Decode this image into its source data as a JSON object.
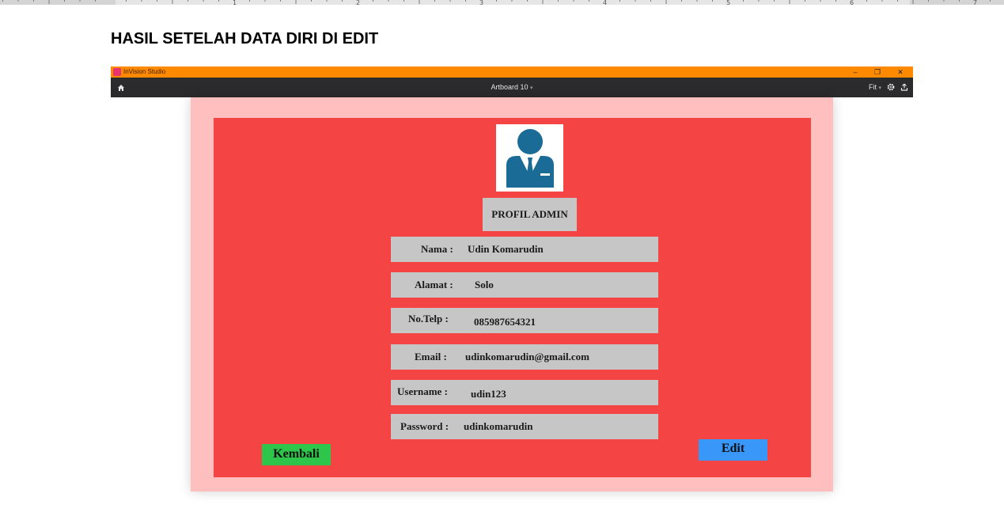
{
  "document": {
    "heading": "HASIL SETELAH DATA DIRI DI EDIT",
    "ruler_numbers": [
      "1",
      "2",
      "3",
      "4",
      "5",
      "6",
      "7"
    ]
  },
  "window": {
    "app_title": "InVision Studio",
    "controls": {
      "minimize": "–",
      "restore": "❐",
      "close": "✕"
    },
    "artboard_label": "Artboard 10",
    "zoom_label": "Fit",
    "accent_titlebar": "#ff8a00",
    "toolbar_color": "#2b2b2d",
    "icons": {
      "home": "home-icon",
      "settings": "gear-icon",
      "share": "upload-icon",
      "logo": "invision-logo-icon"
    }
  },
  "profile": {
    "title": "PROFIL ADMIN",
    "avatar_icon": "admin-user-icon",
    "fields": [
      {
        "label": "Nama  :",
        "value": "Udin Komarudin"
      },
      {
        "label": "Alamat :",
        "value": "Solo"
      },
      {
        "label": "No.Telp :",
        "value": "085987654321"
      },
      {
        "label": "Email :",
        "value": "udinkomarudin@gmail.com"
      },
      {
        "label": "Username :",
        "value": "udin123"
      },
      {
        "label": "Password :",
        "value": "udinkomarudin"
      }
    ],
    "buttons": {
      "back": "Kembali",
      "edit": "Edit"
    },
    "colors": {
      "canvas": "#ffbfbf",
      "panel": "#f44444",
      "field": "#c6c6c6",
      "back_button": "#2dc64a",
      "edit_button": "#3897f8",
      "avatar": "#1a6c96"
    }
  }
}
